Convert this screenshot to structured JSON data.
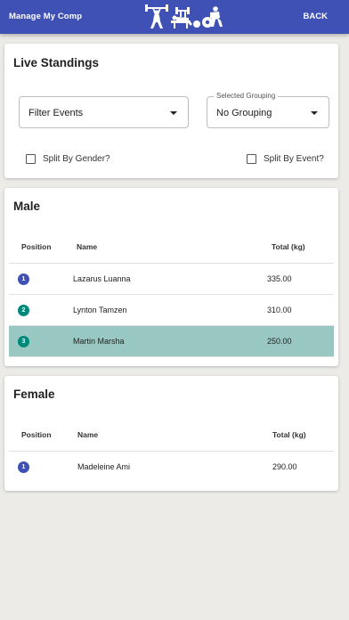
{
  "appbar": {
    "title": "Manage My Comp",
    "back_label": "BACK",
    "logo_icon": "weightlifting-figures-icon"
  },
  "standings": {
    "title": "Live Standings",
    "filter": {
      "value": "Filter Events"
    },
    "grouping": {
      "label": "Selected Grouping",
      "value": "No Grouping"
    },
    "split_gender": {
      "label": "Split By Gender?",
      "checked": false
    },
    "split_event": {
      "label": "Split By Event?",
      "checked": false
    }
  },
  "groups": [
    {
      "title": "Male",
      "columns": {
        "position": "Position",
        "name": "Name",
        "total": "Total (kg)"
      },
      "rows": [
        {
          "rank": "1",
          "name": "Lazarus Luanna",
          "total": "335.00",
          "badge": "#3f51b5"
        },
        {
          "rank": "2",
          "name": "Lynton Tamzen",
          "total": "310.00",
          "badge": "#00897b"
        },
        {
          "rank": "3",
          "name": "Martin Marsha",
          "total": "250.00",
          "badge": "#00897b",
          "highlight": true
        }
      ]
    },
    {
      "title": "Female",
      "columns": {
        "position": "Position",
        "name": "Name",
        "total": "Total (kg)"
      },
      "rows": [
        {
          "rank": "1",
          "name": "Madeleine Ami",
          "total": "290.00",
          "badge": "#3f51b5"
        }
      ]
    }
  ],
  "colors": {
    "primary": "#3f51b5",
    "teal": "#00897b",
    "highlight_row": "#99c8c2",
    "background": "#ecebe7"
  }
}
